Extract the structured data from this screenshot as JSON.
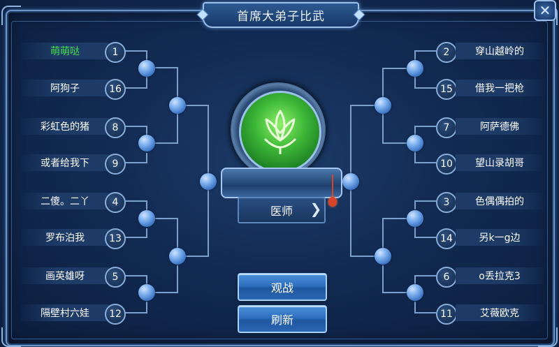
{
  "title": "首席大弟子比武",
  "close_icon": "close-icon",
  "left_bracket": [
    {
      "name": "萌萌哒",
      "seed": "1",
      "highlight": true
    },
    {
      "name": "阿狗子",
      "seed": "16"
    },
    {
      "name": "彩虹色的猪",
      "seed": "8"
    },
    {
      "name": "或者给我下",
      "seed": "9"
    },
    {
      "name": "二傻。二丫",
      "seed": "4"
    },
    {
      "name": "罗布泊我",
      "seed": "13"
    },
    {
      "name": "画英雄呀",
      "seed": "5"
    },
    {
      "name": "隔壁村六娃",
      "seed": "12"
    }
  ],
  "right_bracket": [
    {
      "name": "穿山越岭的",
      "seed": "2"
    },
    {
      "name": "借我一把枪",
      "seed": "15"
    },
    {
      "name": "阿萨德佛",
      "seed": "7"
    },
    {
      "name": "望山录胡哥",
      "seed": "10"
    },
    {
      "name": "色偶偶拍的",
      "seed": "3"
    },
    {
      "name": "另k一g边",
      "seed": "14"
    },
    {
      "name": "o丢拉克3",
      "seed": "6"
    },
    {
      "name": "艾薇欧克",
      "seed": "11"
    }
  ],
  "center": {
    "emblem_icon": "lotus-icon",
    "class_label": "医师",
    "next_icon": "chevron-right-icon"
  },
  "buttons": {
    "watch": "观战",
    "refresh": "刷新"
  },
  "colors": {
    "highlight_name": "#3ee24a",
    "node": "#5b95dd",
    "frame": "#6f93c2"
  }
}
